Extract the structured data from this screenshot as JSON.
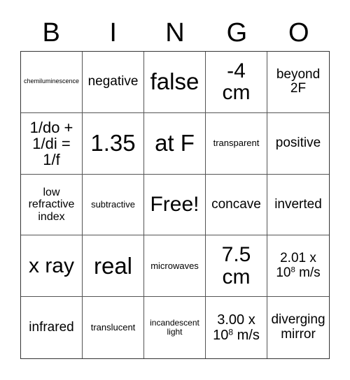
{
  "header": {
    "letters": [
      "B",
      "I",
      "N",
      "G",
      "O"
    ]
  },
  "board": {
    "rows": [
      [
        {
          "text": "chemiluminescence"
        },
        {
          "text": "negative"
        },
        {
          "text": "false"
        },
        {
          "text": "-4 cm"
        },
        {
          "text": "beyond 2F"
        }
      ],
      [
        {
          "text": "1/do + 1/di = 1/f"
        },
        {
          "text": "1.35"
        },
        {
          "text": "at F"
        },
        {
          "text": "transparent"
        },
        {
          "text": "positive"
        }
      ],
      [
        {
          "text": "low refractive index"
        },
        {
          "text": "subtractive"
        },
        {
          "text": "Free!"
        },
        {
          "text": "concave"
        },
        {
          "text": "inverted"
        }
      ],
      [
        {
          "text": "x ray"
        },
        {
          "text": "real"
        },
        {
          "text": "microwaves"
        },
        {
          "text": "7.5 cm"
        },
        {
          "base": "2.01 x 10",
          "exp": "8",
          "unit": " m/s"
        }
      ],
      [
        {
          "text": "infrared"
        },
        {
          "text": "translucent"
        },
        {
          "text": "incandescent light"
        },
        {
          "base": "3.00 x 10",
          "exp": "8",
          "unit": " m/s"
        },
        {
          "text": "diverging mirror"
        }
      ]
    ]
  }
}
